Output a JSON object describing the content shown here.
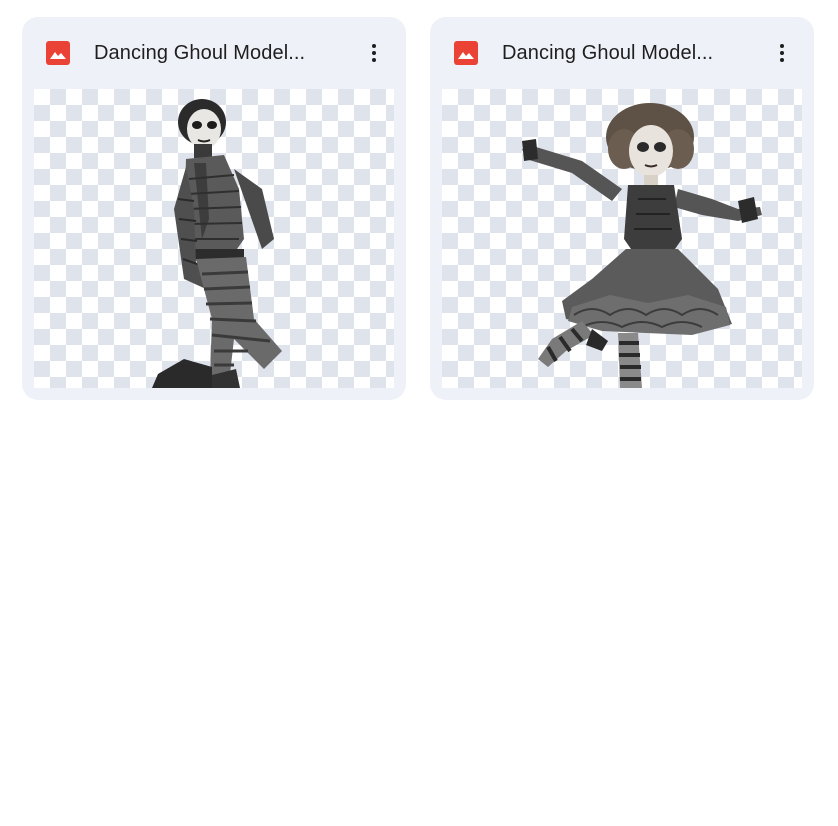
{
  "files": [
    {
      "name": "Dancing Ghoul Model...",
      "icon": "image-file-icon",
      "icon_color": "#ea4335",
      "more_icon": "more-vert-icon",
      "thumbnail": "dancing-ghoul-boy"
    },
    {
      "name": "Dancing Ghoul Model...",
      "icon": "image-file-icon",
      "icon_color": "#ea4335",
      "more_icon": "more-vert-icon",
      "thumbnail": "dancing-ghoul-girl"
    }
  ]
}
